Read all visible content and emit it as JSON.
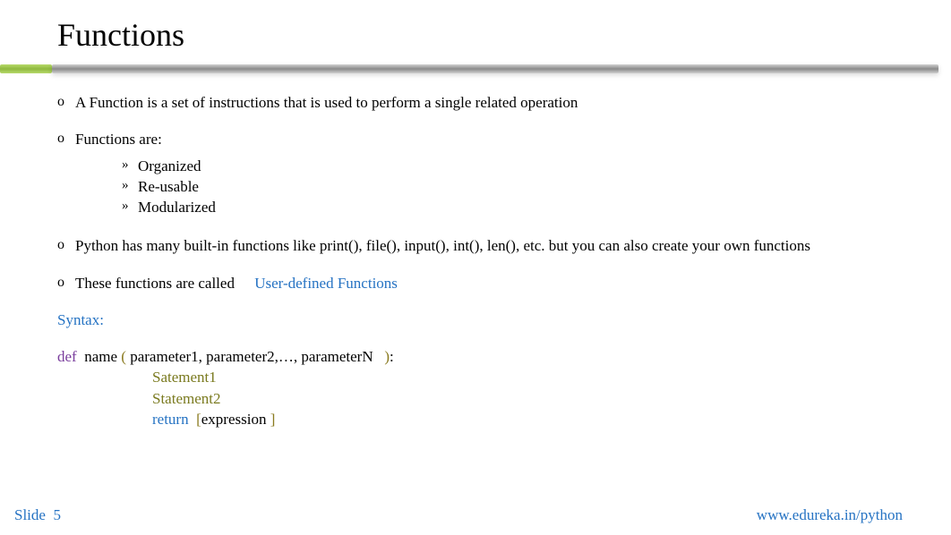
{
  "title": "Functions",
  "bullets": {
    "b1": "A Function is a set of instructions that is used to perform a single related operation",
    "b2": "Functions are:",
    "sub1": "Organized",
    "sub2": "Re-usable",
    "sub3": "Modularized",
    "b3": "Python has many built-in functions like print(), file(), input(), int(), len(), etc. but you can also create your own functions",
    "b4_a": "These functions are called",
    "b4_b": "User-defined Functions"
  },
  "syntax_label": "Syntax:",
  "code": {
    "def": "def",
    "name": "name",
    "lparen": "(",
    "params": "parameter1, parameter2,…,    parameterN",
    "rparen": ")",
    "colon": ":",
    "stmt1": "Satement1",
    "stmt2": "Statement2",
    "return": "return",
    "lbracket": "[",
    "expr": "expression",
    "rbracket": "]"
  },
  "footer": {
    "slide_label": "Slide",
    "slide_num": "5",
    "url": "www.edureka.in/python"
  }
}
